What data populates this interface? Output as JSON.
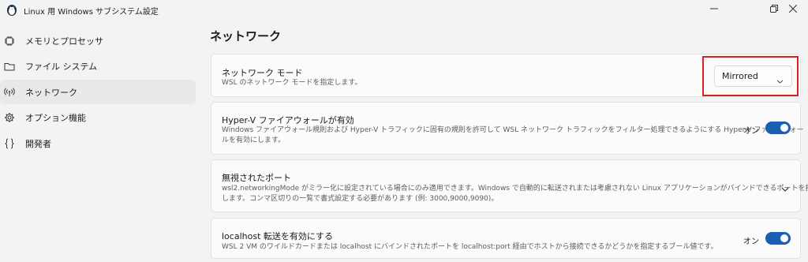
{
  "window": {
    "title": "Linux 用 Windows サブシステム設定",
    "icon": "penguin-icon"
  },
  "sidebar": {
    "items": [
      {
        "label": "メモリとプロセッサ",
        "icon": "chip-icon"
      },
      {
        "label": "ファイル システム",
        "icon": "folder-icon"
      },
      {
        "label": "ネットワーク",
        "icon": "antenna-icon",
        "active": true
      },
      {
        "label": "オプション機能",
        "icon": "gear-icon"
      },
      {
        "label": "開発者",
        "icon": "braces-icon"
      }
    ]
  },
  "page": {
    "title": "ネットワーク"
  },
  "settings": {
    "network_mode": {
      "title": "ネットワーク モード",
      "description": "WSL のネットワーク モードを指定します。",
      "value": "Mirrored"
    },
    "hyperv_firewall": {
      "title": "Hyper-V ファイアウォールが有効",
      "description_line1": "Windows ファイアウォール規則および Hyper-V トラフィックに固有の規則を許可して WSL ネットワーク トラフィックをフィルター処理できるようにする Hyper-V ファイアウォー",
      "description_line2": "ルを有効にします。",
      "toggle_label": "オン",
      "on": true
    },
    "ignored_ports": {
      "title": "無視されたポート",
      "description_line1": "wsl2.networkingMode がミラー化に設定されている場合にのみ適用できます。Windows で自動的に転送されまたは考慮されない Linux アプリケーションがバインドできるポートを指定",
      "description_line2": "します。コンマ区切りの一覧で書式設定する必要があります (例: 3000,9000,9090)。"
    },
    "localhost_forwarding": {
      "title": "localhost 転送を有効にする",
      "description": "WSL 2 VM のワイルドカードまたは localhost にバインドされたポートを localhost:port 経由でホストから接続できるかどうかを指定するブール値です。",
      "toggle_label": "オン",
      "on": true
    }
  },
  "colors": {
    "accent": "#1a5fb4",
    "highlight": "#d92121"
  }
}
